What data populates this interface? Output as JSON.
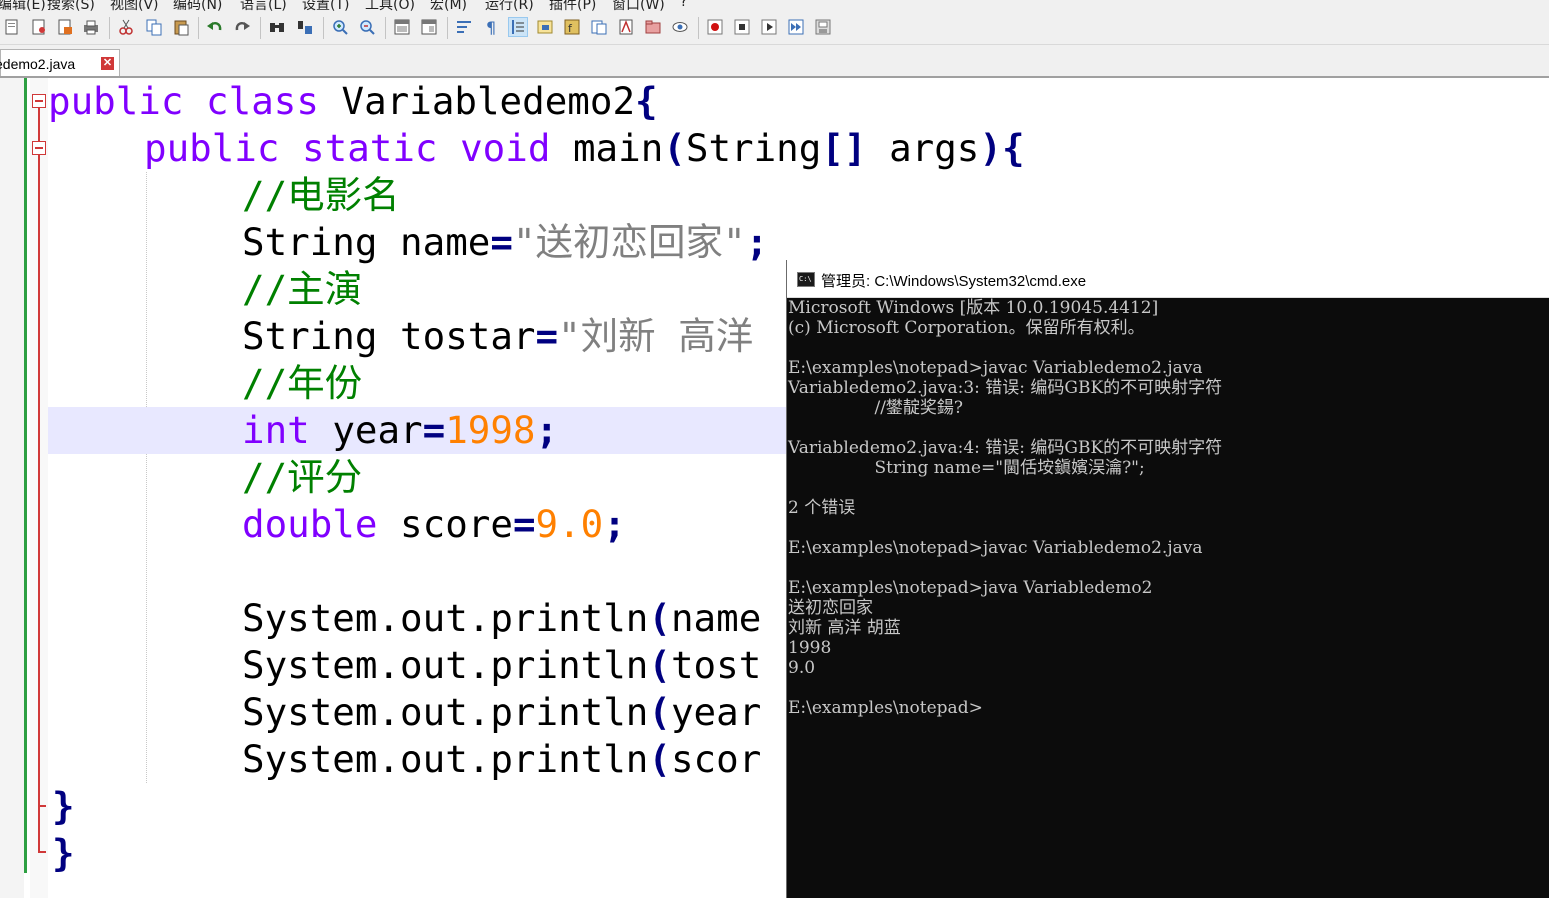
{
  "menu": {
    "items": [
      "编辑(E)",
      "搜索(S)",
      "视图(V)",
      "编码(N)",
      "语言(L)",
      "设置(T)",
      "工具(O)",
      "宏(M)",
      "运行(R)",
      "插件(P)",
      "窗口(W)",
      "?"
    ]
  },
  "toolbar": {
    "icons": [
      "new-file-icon",
      "open-file-icon",
      "save-icon",
      "save-all-icon",
      "close-icon",
      "close-all-icon",
      "print-icon",
      "cut-icon",
      "copy-icon",
      "paste-icon",
      "undo-icon",
      "redo-icon",
      "find-icon",
      "replace-icon",
      "zoom-in-icon",
      "zoom-out-icon",
      "sync-vertical-icon",
      "sync-horizontal-icon",
      "word-wrap-icon",
      "show-all-chars-icon",
      "indent-guide-icon",
      "doc-map-icon",
      "function-list-icon",
      "folder-workspace-icon",
      "monitoring-icon",
      "record-macro-icon",
      "stop-record-icon",
      "play-macro-icon",
      "run-macro-multiple-icon",
      "save-macro-icon"
    ]
  },
  "tab": {
    "label": "edemo2.java",
    "close_symbol": "✕"
  },
  "editor": {
    "lines": {
      "l1": {
        "kw1": "public",
        "kw2": "class",
        "name": "Variabledemo2",
        "brace": "{"
      },
      "l2": {
        "kw1": "public",
        "kw2": "static",
        "kw3": "void",
        "main": "main",
        "lp": "(",
        "type": "String",
        "br": "[]",
        "args": "args",
        "rp": ")",
        "brace": "{"
      },
      "l3": {
        "comment": "//电影名"
      },
      "l4": {
        "type": "String",
        "var": "name",
        "eq": "=",
        "str": "\"送初恋回家\"",
        "semi": ";"
      },
      "l5": {
        "comment": "//主演"
      },
      "l6": {
        "type": "String",
        "var": "tostar",
        "eq": "=",
        "str": "\"刘新 高洋"
      },
      "l7": {
        "comment": "//年份"
      },
      "l8": {
        "type": "int",
        "var": "year",
        "eq": "=",
        "num": "1998",
        "semi": ";"
      },
      "l9": {
        "comment": "//评分"
      },
      "l10": {
        "type": "double",
        "var": "score",
        "eq": "=",
        "num": "9.0",
        "semi": ";"
      },
      "l12": {
        "call": "System.out.println",
        "lp": "(",
        "arg": "name"
      },
      "l13": {
        "call": "System.out.println",
        "lp": "(",
        "arg": "tost"
      },
      "l14": {
        "call": "System.out.println",
        "lp": "(",
        "arg": "year"
      },
      "l15": {
        "call": "System.out.println",
        "lp": "(",
        "arg": "scor"
      },
      "l16": {
        "brace": "}"
      },
      "l17": {
        "brace": "}"
      }
    }
  },
  "cmd": {
    "title": "管理员: C:\\Windows\\System32\\cmd.exe",
    "icon_text": "C:\\",
    "lines": [
      "Microsoft Windows [版本 10.0.19045.4412]",
      "(c) Microsoft Corporation。保留所有权利。",
      "",
      "E:\\examples\\notepad>javac Variabledemo2.java",
      "Variabledemo2.java:3: 错误: 编码GBK的不可映射字符",
      "                //鐢靛奖鍚?",
      "",
      "Variabledemo2.java:4: 错误: 编码GBK的不可映射字符",
      "                String name=\"閫佸垵鎭嬪洖瀹?\";",
      "",
      "2 个错误",
      "",
      "E:\\examples\\notepad>javac Variabledemo2.java",
      "",
      "E:\\examples\\notepad>java Variabledemo2",
      "送初恋回家",
      "刘新 高洋 胡蓝",
      "1998",
      "9.0",
      "",
      "E:\\examples\\notepad>"
    ]
  }
}
